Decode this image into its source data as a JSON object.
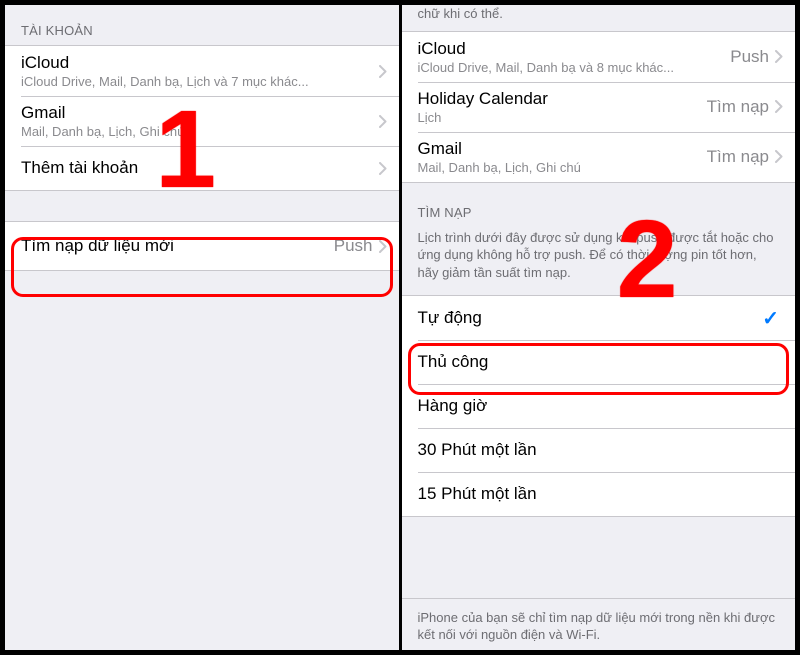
{
  "step_labels": {
    "one": "1",
    "two": "2"
  },
  "left": {
    "section_header": "TÀI KHOẢN",
    "accounts": [
      {
        "title": "iCloud",
        "sub": "iCloud Drive, Mail, Danh bạ, Lịch và 7 mục khác..."
      },
      {
        "title": "Gmail",
        "sub": "Mail, Danh bạ, Lịch, Ghi chú"
      }
    ],
    "add_account": "Thêm tài khoản",
    "fetch_row": {
      "title": "Tìm nạp dữ liệu mới",
      "value": "Push"
    }
  },
  "right": {
    "top_cut": "chữ khi có thể.",
    "accounts": [
      {
        "title": "iCloud",
        "sub": "iCloud Drive, Mail, Danh bạ và 8 mục khác...",
        "value": "Push"
      },
      {
        "title": "Holiday Calendar",
        "sub": "Lịch",
        "value": "Tìm nạp"
      },
      {
        "title": "Gmail",
        "sub": "Mail, Danh bạ, Lịch, Ghi chú",
        "value": "Tìm nạp"
      }
    ],
    "fetch_header": "TÌM NẠP",
    "fetch_desc": "Lịch trình dưới đây được sử dụng khi push được tắt hoặc cho ứng dụng không hỗ trợ push. Để có thời lượng pin tốt hơn, hãy giảm tần suất tìm nạp.",
    "schedule": [
      {
        "label": "Tự động",
        "selected": true
      },
      {
        "label": "Thủ công",
        "selected": false
      },
      {
        "label": "Hàng giờ",
        "selected": false
      },
      {
        "label": "30 Phút một lần",
        "selected": false
      },
      {
        "label": "15 Phút một lần",
        "selected": false
      }
    ],
    "bottom_note": "iPhone của bạn sẽ chỉ tìm nạp dữ liệu mới trong nền khi được kết nối với nguồn điện và Wi-Fi."
  }
}
